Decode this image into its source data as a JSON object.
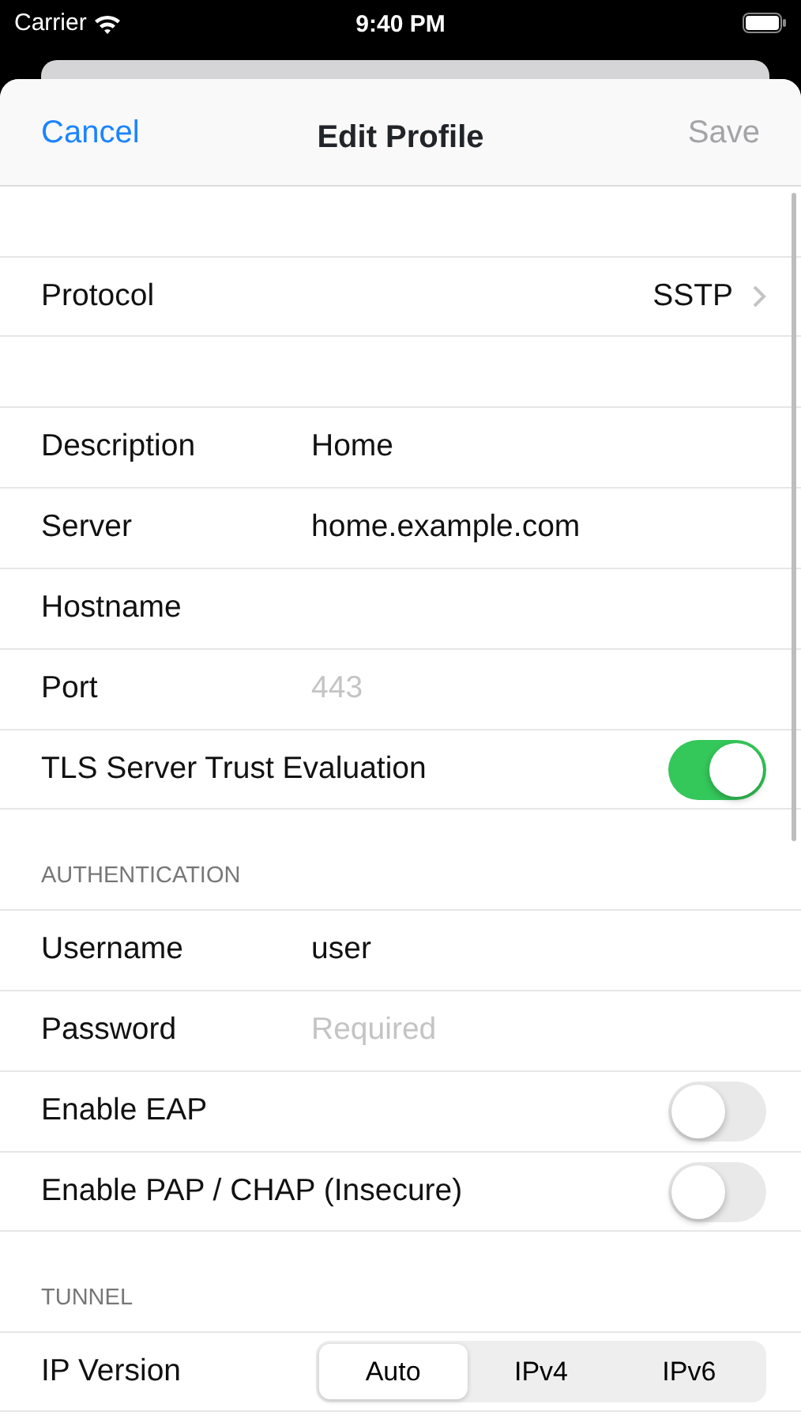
{
  "status_bar": {
    "carrier": "Carrier",
    "time": "9:40 PM"
  },
  "nav": {
    "cancel": "Cancel",
    "title": "Edit Profile",
    "save": {
      "label": "Save",
      "disabled": true
    }
  },
  "sections": [
    {
      "rows": [
        {
          "kind": "disclosure",
          "label": "Protocol",
          "value": "SSTP"
        }
      ]
    },
    {
      "rows": [
        {
          "kind": "text",
          "label": "Description",
          "value": "Home"
        },
        {
          "kind": "text",
          "label": "Server",
          "value": "home.example.com"
        },
        {
          "kind": "text",
          "label": "Hostname"
        },
        {
          "kind": "text",
          "label": "Port",
          "placeholder": "443"
        },
        {
          "kind": "toggle",
          "label": "TLS Server Trust Evaluation",
          "on": true
        }
      ]
    },
    {
      "header": "AUTHENTICATION",
      "rows": [
        {
          "kind": "text",
          "label": "Username",
          "value": "user"
        },
        {
          "kind": "text",
          "label": "Password",
          "placeholder": "Required"
        },
        {
          "kind": "toggle",
          "label": "Enable EAP",
          "on": false
        },
        {
          "kind": "toggle",
          "label": "Enable PAP / CHAP (Insecure)",
          "on": false
        }
      ]
    },
    {
      "header": "TUNNEL",
      "rows": [
        {
          "kind": "segmented",
          "label": "IP Version",
          "segments": [
            {
              "label": "Auto",
              "selected": true
            },
            {
              "label": "IPv4",
              "selected": false
            },
            {
              "label": "IPv6",
              "selected": false
            }
          ]
        }
      ]
    }
  ]
}
